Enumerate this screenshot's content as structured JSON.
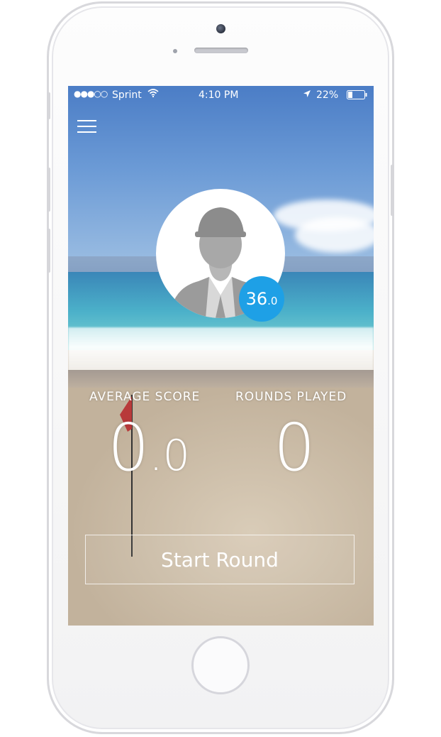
{
  "status_bar": {
    "signal": "●●●○○",
    "carrier": "Sprint",
    "time": "4:10 PM",
    "battery": "22%"
  },
  "header": {
    "menu_icon": "hamburger-menu-icon"
  },
  "profile": {
    "avatar_icon": "golfer-avatar-icon",
    "handicap_main": "36",
    "handicap_decimal": ".0",
    "badge_color": "#1ea0e6"
  },
  "stats": {
    "average_label": "AVERAGE SCORE",
    "average_main": "0",
    "average_decimal": ".0",
    "rounds_label": "ROUNDS PLAYED",
    "rounds_value": "0"
  },
  "actions": {
    "start_label": "Start Round"
  }
}
